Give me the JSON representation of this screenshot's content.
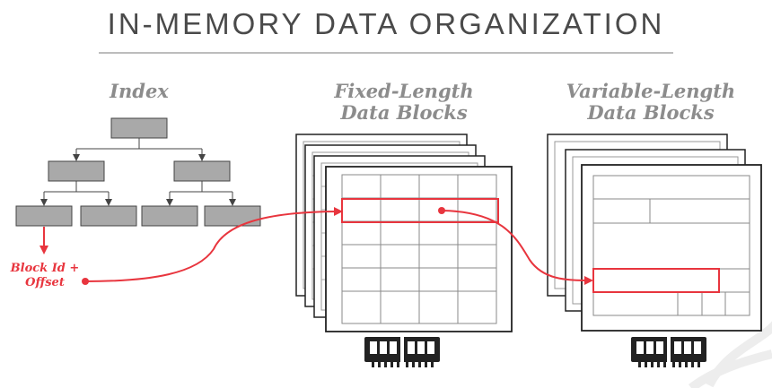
{
  "title": "IN-MEMORY DATA ORGANIZATION",
  "columns": {
    "index": "Index",
    "fixed": [
      "Fixed-Length",
      "Data Blocks"
    ],
    "variable": [
      "Variable-Length",
      "Data Blocks"
    ]
  },
  "annotation": [
    "Block Id +",
    "Offset"
  ],
  "colors": {
    "accent": "#e8353e",
    "node_fill": "#a9a9a9",
    "text_gray": "#8c8c8c",
    "grid_line": "#8a8a8a"
  },
  "icons": [
    "index-tree",
    "memory-chip-icon",
    "memory-chip-icon"
  ]
}
